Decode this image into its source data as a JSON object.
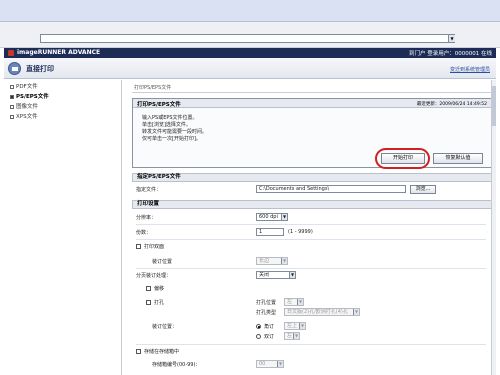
{
  "browser": {
    "address_value": "",
    "address_dropdown": "▼"
  },
  "header": {
    "app_title": "imageRUNNER ADVANCE",
    "links": "到门户 登录用户：0000001 在线"
  },
  "subheader": {
    "page_heading": "直接打印",
    "admin_link": "变迁到系统管理员"
  },
  "sidebar": {
    "items": [
      {
        "label": "PDF文件",
        "active": false
      },
      {
        "label": "PS/EPS文件",
        "active": true
      },
      {
        "label": "图像文件",
        "active": false
      },
      {
        "label": "XPS文件",
        "active": false
      }
    ]
  },
  "main": {
    "breadcrumb": "打印PS/EPS文件",
    "panel": {
      "title": "打印PS/EPS文件",
      "updated": "最近更新：2009/06/24 14:49:52",
      "instructions": [
        "输入PS或EPS文件位置。",
        "单击[浏览]选择文件。",
        "转发文件可能需要一段时间。",
        "仅可单击一次[开始打印]。"
      ],
      "start_button": "开始打印",
      "restore_button": "恢复默认值"
    },
    "file_section": {
      "title": "指定PS/EPS文件",
      "file_label": "指定文件：",
      "file_value": "C:\\Documents and Settings\\",
      "browse_button": "浏览..."
    },
    "print_settings": {
      "title": "打印设置",
      "resolution_label": "分辨率：",
      "resolution_value": "600 dpi",
      "copies_label": "份数：",
      "copies_value": "1",
      "copies_range": "(1 - 9999)",
      "duplex_label": "打印双面",
      "binding_label": "装订位置",
      "binding_value": "长边",
      "finishing_label": "分页装订处理：",
      "finishing_value": "关闭",
      "offset_label": "偏移",
      "punch_label": "打孔",
      "punch_position_label": "打孔位置",
      "punch_position_value": "左",
      "punch_type_label": "打孔类型",
      "punch_type_value": "日文版(2)孔/欧洲打孔(4)孔",
      "staple_label": "装订位置：",
      "staple_corner_label": "角订",
      "staple_corner_value": "左上",
      "staple_double_label": "双订",
      "staple_double_value": "左",
      "store_label": "存储在存储箱中",
      "store_box_label": "存储箱编号(00-99)：",
      "store_box_value": "00"
    }
  }
}
